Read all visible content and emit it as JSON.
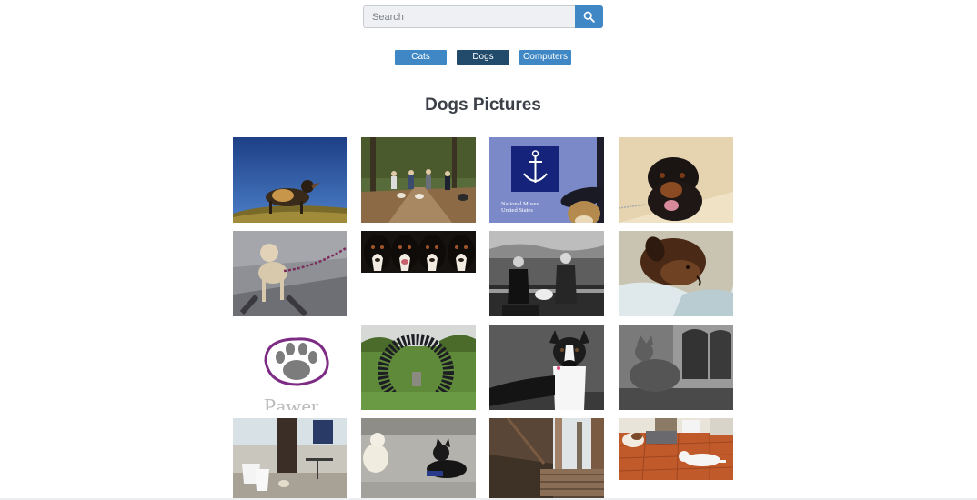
{
  "search": {
    "placeholder": "Search"
  },
  "categories": {
    "cats": "Cats",
    "dogs": "Dogs",
    "computers": "Computers"
  },
  "page_title": "Dogs Pictures",
  "photo_texts": {
    "museum_line1": "National Museu",
    "museum_line2": "United States",
    "pawer": "Pawer"
  },
  "colors": {
    "accent": "#3f88c5",
    "active": "#224a6b",
    "title": "#3c4048"
  }
}
